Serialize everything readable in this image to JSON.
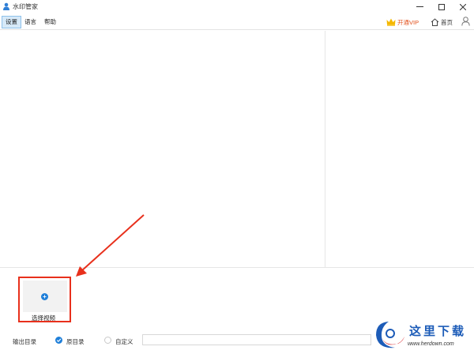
{
  "window": {
    "title": "水印管家",
    "app_icon": "person-icon",
    "controls": [
      "minimize-icon",
      "maximize-icon",
      "close-icon"
    ]
  },
  "menu": {
    "items": [
      {
        "label": "设置",
        "active": true
      },
      {
        "label": "语言",
        "active": false
      },
      {
        "label": "帮助",
        "active": false
      }
    ],
    "vip_label": "开通VIP",
    "vip_icon": "crown-icon",
    "home_label": "首页",
    "home_icon": "home-icon",
    "user_icon": "user-icon"
  },
  "select_video": {
    "label": "选择视频",
    "icon": "plus-icon"
  },
  "output": {
    "label": "输出目录",
    "options": [
      {
        "label": "原目录",
        "checked": true
      },
      {
        "label": "自定义",
        "checked": false
      }
    ],
    "path_value": ""
  },
  "watermark": {
    "title": "这里下载",
    "url": "www.herdown.com"
  },
  "colors": {
    "accent": "#1f7fd9",
    "vip": "#e2501b",
    "annotation": "#e8301c",
    "watermark": "#1d5cb8"
  }
}
